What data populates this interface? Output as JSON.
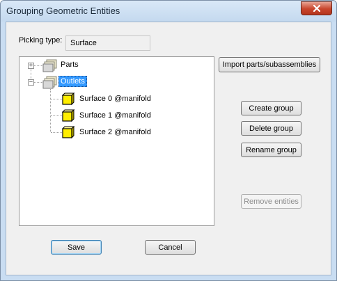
{
  "window": {
    "title": "Grouping Geometric Entities"
  },
  "picking": {
    "label": "Picking type:",
    "value": "Surface"
  },
  "tree": {
    "nodes": [
      {
        "label": "Parts",
        "expander": "+"
      },
      {
        "label": "Outlets",
        "expander": "−",
        "selected": true
      }
    ],
    "children": [
      {
        "label": "Surface 0 @manifold"
      },
      {
        "label": "Surface 1 @manifold"
      },
      {
        "label": "Surface 2 @manifold"
      }
    ]
  },
  "buttons": {
    "import": "Import parts/subassemblies",
    "create_group": "Create group",
    "delete_group": "Delete group",
    "rename_group": "Rename group",
    "remove_entities": "Remove entities",
    "save": "Save",
    "cancel": "Cancel"
  },
  "colors": {
    "selection": "#3399ff",
    "window_frame": "#c9ddf2",
    "close_button": "#c8452c"
  }
}
